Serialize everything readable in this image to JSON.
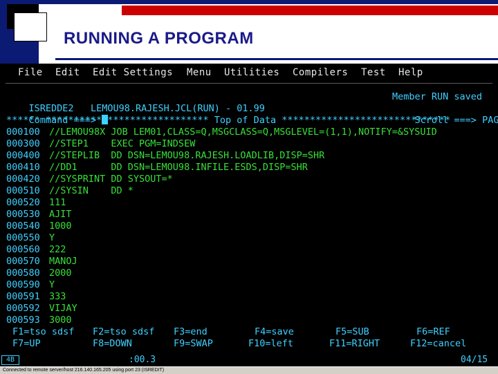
{
  "slide": {
    "title": "RUNNING A PROGRAM"
  },
  "menu": [
    "File",
    "Edit",
    "Edit Settings",
    "Menu",
    "Utilities",
    "Compilers",
    "Test",
    "Help"
  ],
  "header": {
    "panel_id": "ISREDDE2",
    "dataset": "LEMOU98.RAJESH.JCL(RUN) - 01.99",
    "message": "Member RUN saved",
    "command_label": "Command ===>",
    "scroll_label": "Scroll ===>",
    "scroll_value": "PAGE"
  },
  "top_of_data": "****** ***************************** Top of Data ******************************",
  "lines": [
    {
      "seq": "000100",
      "text": "//LEMOU98X JOB LEM01,CLASS=Q,MSGCLASS=Q,MSGLEVEL=(1,1),NOTIFY=&SYSUID"
    },
    {
      "seq": "000300",
      "text": "//STEP1    EXEC PGM=INDSEW"
    },
    {
      "seq": "000400",
      "text": "//STEPLIB  DD DSN=LEMOU98.RAJESH.LOADLIB,DISP=SHR"
    },
    {
      "seq": "000410",
      "text": "//DD1      DD DSN=LEMOU98.INFILE.ESDS,DISP=SHR"
    },
    {
      "seq": "000420",
      "text": "//SYSPRINT DD SYSOUT=*"
    },
    {
      "seq": "000510",
      "text": "//SYSIN    DD *"
    },
    {
      "seq": "000520",
      "text": "111"
    },
    {
      "seq": "000530",
      "text": "AJIT"
    },
    {
      "seq": "000540",
      "text": "1000"
    },
    {
      "seq": "000550",
      "text": "Y"
    },
    {
      "seq": "000560",
      "text": "222"
    },
    {
      "seq": "000570",
      "text": "MANOJ"
    },
    {
      "seq": "000580",
      "text": "2000"
    },
    {
      "seq": "000590",
      "text": "Y"
    },
    {
      "seq": "000591",
      "text": "333"
    },
    {
      "seq": "000592",
      "text": "VIJAY"
    },
    {
      "seq": "000593",
      "text": "3000"
    }
  ],
  "pfkeys_row1": [
    "F1=tso sdsf",
    "F2=tso sdsf",
    "F3=end",
    "F4=save",
    "F5=SUB",
    "F6=REF"
  ],
  "pfkeys_row2": [
    "F7=UP",
    "F8=DOWN",
    "F9=SWAP",
    "F10=left",
    "F11=RIGHT",
    "F12=cancel"
  ],
  "status": {
    "session": "4B",
    "time": ":00.3",
    "position": "04/15"
  },
  "taskbar": {
    "text": "Connected to remote server/host 216.140.165.205 using port 23 (ISREDIT)"
  }
}
